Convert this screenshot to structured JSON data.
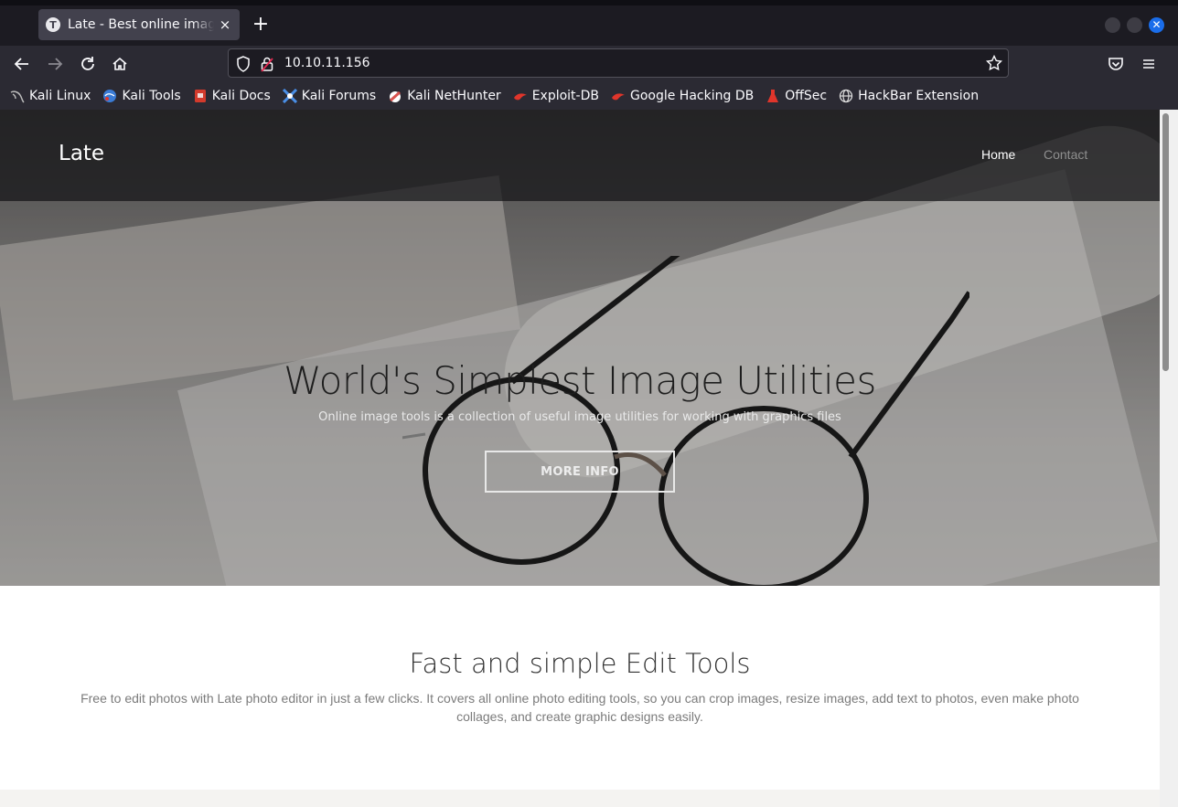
{
  "browser": {
    "tab_title": "Late - Best online image tools",
    "tab_favicon_letter": "T",
    "tab_close_symbol": "×",
    "new_tab_symbol": "+",
    "url": "10.10.11.156",
    "window_close_symbol": "✕"
  },
  "bookmarks": [
    {
      "label": "Kali Linux",
      "icon": "kali-dragon-icon",
      "color": "#aaaaaa"
    },
    {
      "label": "Kali Tools",
      "icon": "kali-tools-icon",
      "color": "#3a7bd5"
    },
    {
      "label": "Kali Docs",
      "icon": "kali-docs-icon",
      "color": "#d33a2c"
    },
    {
      "label": "Kali Forums",
      "icon": "kali-forums-icon",
      "color": "#4a8fe7"
    },
    {
      "label": "Kali NetHunter",
      "icon": "kali-nethunter-icon",
      "color": "#d9534f"
    },
    {
      "label": "Exploit-DB",
      "icon": "exploit-db-icon",
      "color": "#e0352b"
    },
    {
      "label": "Google Hacking DB",
      "icon": "ghdb-icon",
      "color": "#e0352b"
    },
    {
      "label": "OffSec",
      "icon": "offsec-icon",
      "color": "#e0352b"
    },
    {
      "label": "HackBar Extension",
      "icon": "globe-icon",
      "color": "#dddddd"
    }
  ],
  "site": {
    "brand": "Late",
    "nav": {
      "home": "Home",
      "contact": "Contact"
    },
    "hero": {
      "title": "World's Simplest Image Utilities",
      "subtitle": "Online image tools is a collection of useful image utilities for working with graphics files",
      "button": "MORE INFO"
    },
    "section": {
      "title": "Fast and simple Edit Tools",
      "text": "Free to edit photos with Late photo editor in just a few clicks. It covers all online photo editing tools, so you can crop images, resize images, add text to photos, even make photo collages, and create graphic designs easily."
    }
  },
  "colors": {
    "chrome_dark": "#1c1b22",
    "chrome_toolbar": "#2b2a33",
    "tab_active": "#42414d",
    "accent_blue": "#1a6dea",
    "header_overlay": "rgba(20,20,22,0.72)"
  }
}
